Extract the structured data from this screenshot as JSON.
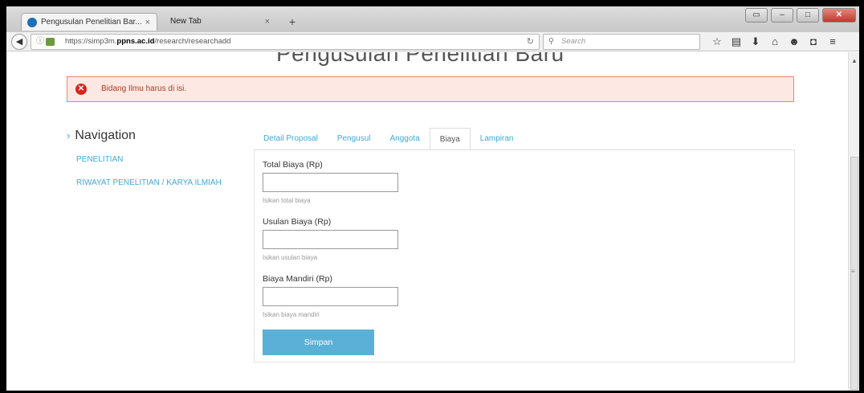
{
  "browser": {
    "active_tab": "Pengusulan Penelitian Bar...",
    "inactive_tab": "New Tab",
    "tab_close": "×",
    "new_tab": "+",
    "url_prefix": "https://simp3m.",
    "url_domain": "ppns.ac.id",
    "url_path": "/research/researchadd",
    "search_placeholder": "Search"
  },
  "page": {
    "title": "Pengusulan Penelitian Baru",
    "alert": "Bidang Ilmu harus di isi."
  },
  "nav": {
    "heading": "Navigation",
    "items": [
      {
        "label": "PENELITIAN"
      },
      {
        "label": "RIWAYAT PENELITIAN / KARYA ILMIAH"
      }
    ]
  },
  "form": {
    "tabs": [
      {
        "label": "Detail Proposal"
      },
      {
        "label": "Pengusul"
      },
      {
        "label": "Anggota"
      },
      {
        "label": "Biaya",
        "active": true
      },
      {
        "label": "Lampiran"
      }
    ],
    "fields": [
      {
        "label": "Total Biaya (Rp)",
        "value": "",
        "help": "Isikan total biaya"
      },
      {
        "label": "Usulan Biaya (Rp)",
        "value": "",
        "help": "Isikan usulan biaya"
      },
      {
        "label": "Biaya Mandiri (Rp)",
        "value": "",
        "help": "Isikan biaya mandiri"
      }
    ],
    "submit_label": "Simpan"
  },
  "colors": {
    "accent": "#5ab0d7",
    "link": "#3fa9d6",
    "alert_bg": "#fde8e3",
    "alert_border": "#e08a6c",
    "alert_icon": "#d9231b"
  }
}
